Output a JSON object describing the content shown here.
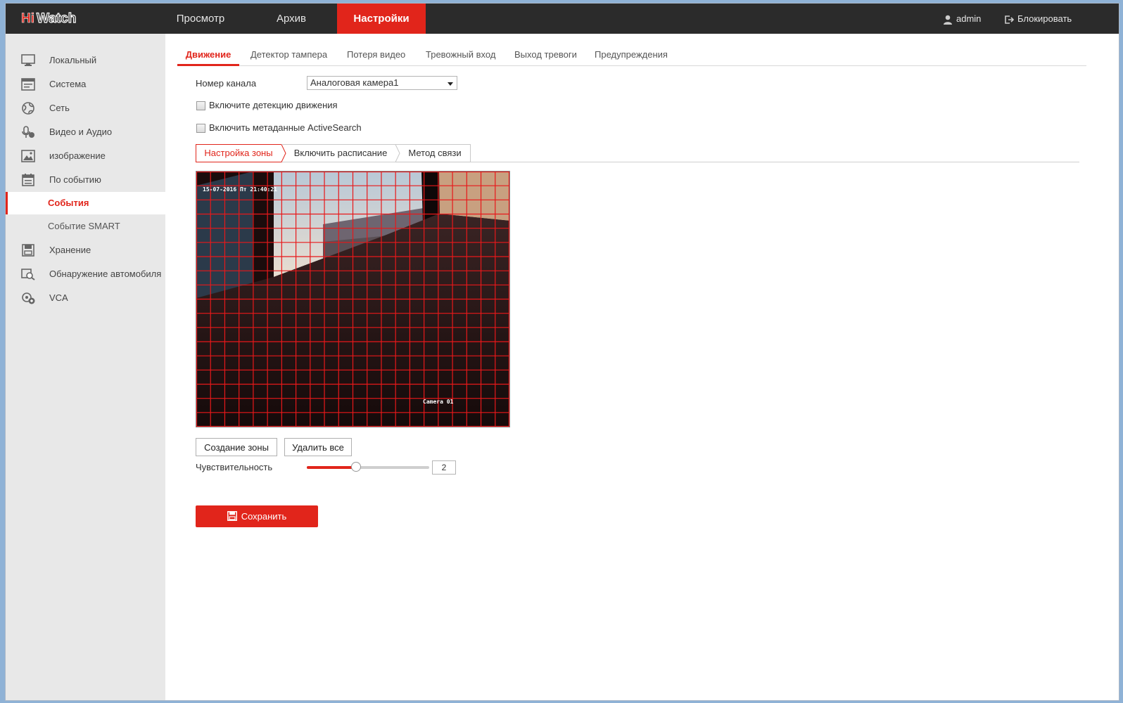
{
  "brand": "HiWatch",
  "colors": {
    "accent": "#e1251b",
    "topbar": "#2b2b2b",
    "sidebar": "#e8e8e8"
  },
  "topnav": [
    {
      "label": "Просмотр"
    },
    {
      "label": "Архив"
    },
    {
      "label": "Настройки",
      "active": true
    }
  ],
  "topright": {
    "user": "admin",
    "lock": "Блокировать"
  },
  "sidebar": {
    "items": [
      {
        "label": "Локальный",
        "icon": "monitor-icon"
      },
      {
        "label": "Система",
        "icon": "system-icon"
      },
      {
        "label": "Сеть",
        "icon": "globe-icon"
      },
      {
        "label": "Видео и Аудио",
        "icon": "mic-icon"
      },
      {
        "label": "изображение",
        "icon": "image-icon"
      },
      {
        "label": "По событию",
        "icon": "calendar-icon"
      }
    ],
    "sub": [
      {
        "label": "События",
        "active": true
      },
      {
        "label": "Событие SMART"
      }
    ],
    "items2": [
      {
        "label": "Хранение",
        "icon": "storage-icon"
      },
      {
        "label": "Обнаружение автомобиля",
        "icon": "vehicle-detect-icon"
      },
      {
        "label": "VCA",
        "icon": "vca-icon"
      }
    ]
  },
  "tabs": [
    {
      "label": "Движение",
      "active": true
    },
    {
      "label": "Детектор тампера"
    },
    {
      "label": "Потеря видео"
    },
    {
      "label": "Тревожный вход"
    },
    {
      "label": "Выход тревоги"
    },
    {
      "label": "Предупреждения"
    }
  ],
  "form": {
    "channel_label": "Номер канала",
    "channel_value": "Аналоговая камера1",
    "motion_label": "Включите детекцию движения",
    "motion_checked": false,
    "activesearch_label": "Включить метаданные ActiveSearch",
    "activesearch_checked": false
  },
  "subtabs": [
    {
      "label": "Настройка зоны",
      "active": true
    },
    {
      "label": "Включить расписание"
    },
    {
      "label": "Метод связи"
    }
  ],
  "video": {
    "osd_datetime": "15-07-2016 Пт 21:40:21",
    "osd_camera": "Camera 01",
    "grid_cols": 22,
    "grid_rows": 18
  },
  "buttons": {
    "create_zone": "Создание зоны",
    "delete_all": "Удалить все",
    "save": "Сохранить"
  },
  "sensitivity": {
    "label": "Чувствительность",
    "value": "2",
    "level": 0.4
  }
}
